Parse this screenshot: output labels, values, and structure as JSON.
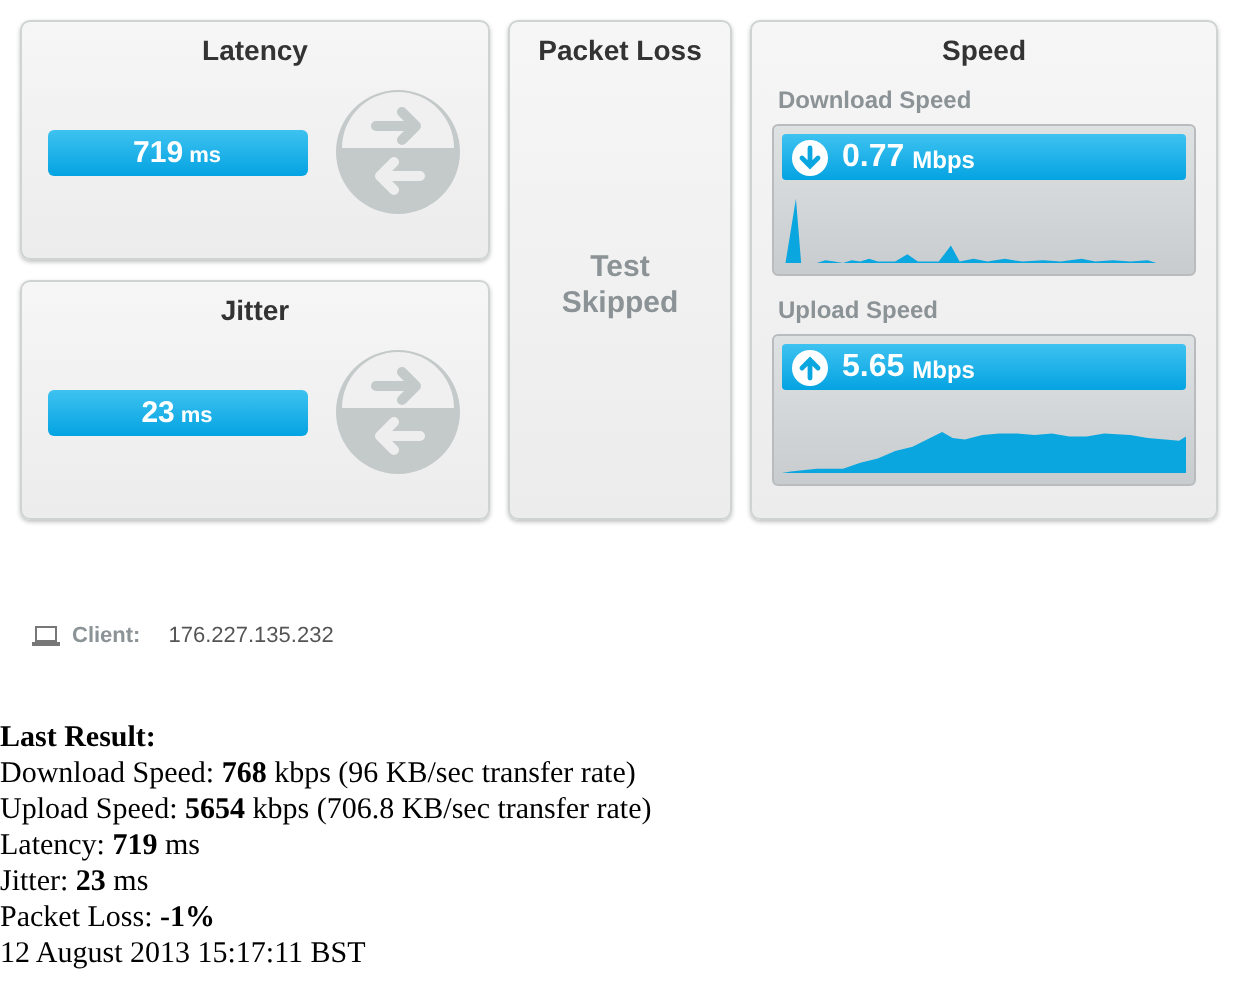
{
  "latency": {
    "title": "Latency",
    "value": "719",
    "unit": "ms"
  },
  "jitter": {
    "title": "Jitter",
    "value": "23",
    "unit": "ms"
  },
  "packet_loss": {
    "title": "Packet Loss",
    "status": "Test Skipped"
  },
  "speed": {
    "title": "Speed",
    "tests": [
      {
        "kind": "download",
        "label": "Download Speed",
        "value": "0.77",
        "unit": "Mbps"
      },
      {
        "kind": "upload",
        "label": "Upload Speed",
        "value": "5.65",
        "unit": "Mbps"
      }
    ]
  },
  "client": {
    "label": "Client:",
    "ip": "176.227.135.232"
  },
  "last_result": {
    "heading": "Last Result:",
    "lines": [
      "Download Speed: **768** kbps (96 KB/sec transfer rate)",
      "Upload Speed: **5654** kbps (706.8 KB/sec transfer rate)",
      "Latency: **719** ms",
      "Jitter: **23** ms",
      "Packet Loss: **-1%**",
      "12 August 2013 15:17:11 BST"
    ]
  }
}
